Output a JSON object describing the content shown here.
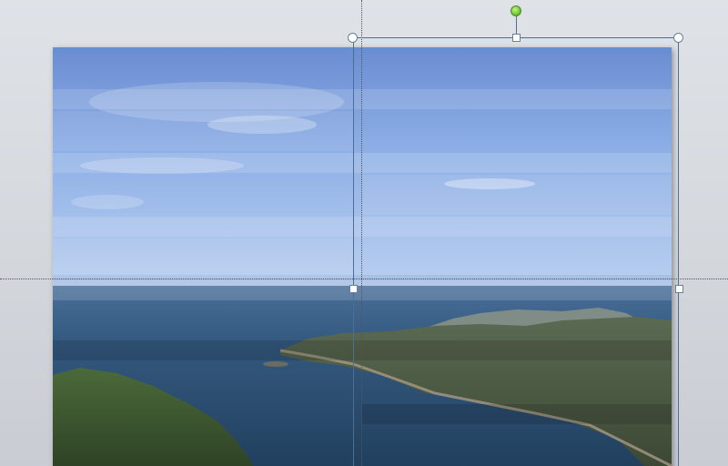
{
  "canvas": {
    "background": "#d7dbe0"
  },
  "image": {
    "name": "coastal-landscape-photo",
    "effect": "horizontal-blinds-transition",
    "colors": {
      "sky_top": "#6d8fd3",
      "sky_bottom": "#a7c3ee",
      "sea": "#2f5377",
      "land": "#3d4d33"
    }
  },
  "selection": {
    "accent": "#4f6e93",
    "rotation_handle_color": "#79c93a"
  }
}
